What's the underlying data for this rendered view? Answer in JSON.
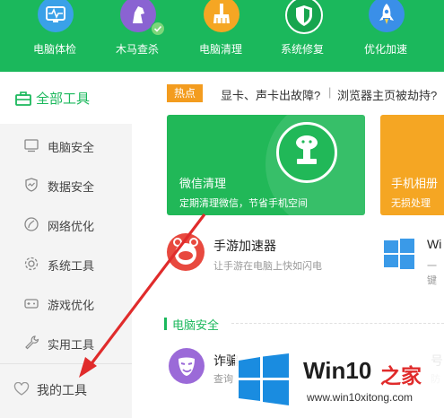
{
  "nav": [
    {
      "label": "电脑体检",
      "icon": "monitor-pulse-icon",
      "color": "#3aa1e8"
    },
    {
      "label": "木马查杀",
      "icon": "horse-icon",
      "color": "#8a63d2"
    },
    {
      "label": "电脑清理",
      "icon": "broom-icon",
      "color": "#f5a623"
    },
    {
      "label": "系统修复",
      "icon": "shield-icon",
      "color": "#17a54e"
    },
    {
      "label": "优化加速",
      "icon": "rocket-icon",
      "color": "#3a8fe8"
    }
  ],
  "sidebar": {
    "title": "全部工具",
    "items": [
      {
        "label": "电脑安全",
        "icon": "computer-icon"
      },
      {
        "label": "数据安全",
        "icon": "data-shield-icon"
      },
      {
        "label": "网络优化",
        "icon": "network-icon"
      },
      {
        "label": "系统工具",
        "icon": "gear-icon"
      },
      {
        "label": "游戏优化",
        "icon": "gamepad-icon"
      },
      {
        "label": "实用工具",
        "icon": "wrench-icon"
      }
    ],
    "my_tools": "我的工具"
  },
  "hot": {
    "badge": "热点",
    "links": [
      "显卡、声卡出故障?",
      "浏览器主页被劫持?"
    ],
    "separator": "|"
  },
  "banners": [
    {
      "title": "微信清理",
      "subtitle": "定期清理微信，节省手机空间",
      "color": "#21b858"
    },
    {
      "title": "手机相册",
      "subtitle": "无损处理",
      "color": "#f5a623"
    }
  ],
  "tools": [
    {
      "title": "手游加速器",
      "subtitle": "让手游在电脑上快如闪电"
    },
    {
      "title": "Wi",
      "subtitle": "一键"
    }
  ],
  "section": {
    "title": "电脑安全"
  },
  "section_tools": [
    {
      "title": "诈骗",
      "subtitle": "查询"
    },
    {
      "title": "号",
      "subtitle": "防"
    }
  ],
  "watermark": {
    "brand_prefix": "Win10",
    "brand_suffix": "之家",
    "url": "www.win10xitong.com"
  },
  "colors": {
    "green": "#1bb85c",
    "orange": "#f39c1f",
    "red": "#e02b2b",
    "win_blue": "#1a8ce0"
  }
}
